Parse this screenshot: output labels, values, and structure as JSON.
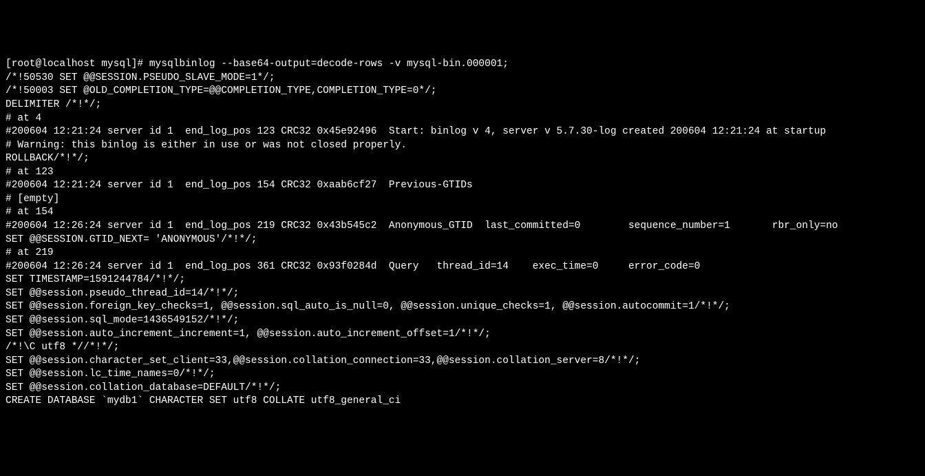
{
  "terminal": {
    "lines": [
      "[root@localhost mysql]# mysqlbinlog --base64-output=decode-rows -v mysql-bin.000001;",
      "/*!50530 SET @@SESSION.PSEUDO_SLAVE_MODE=1*/;",
      "/*!50003 SET @OLD_COMPLETION_TYPE=@@COMPLETION_TYPE,COMPLETION_TYPE=0*/;",
      "DELIMITER /*!*/;",
      "# at 4",
      "#200604 12:21:24 server id 1  end_log_pos 123 CRC32 0x45e92496  Start: binlog v 4, server v 5.7.30-log created 200604 12:21:24 at startup",
      "# Warning: this binlog is either in use or was not closed properly.",
      "ROLLBACK/*!*/;",
      "# at 123",
      "#200604 12:21:24 server id 1  end_log_pos 154 CRC32 0xaab6cf27  Previous-GTIDs",
      "# [empty]",
      "# at 154",
      "#200604 12:26:24 server id 1  end_log_pos 219 CRC32 0x43b545c2  Anonymous_GTID  last_committed=0        sequence_number=1       rbr_only=no",
      "SET @@SESSION.GTID_NEXT= 'ANONYMOUS'/*!*/;",
      "# at 219",
      "#200604 12:26:24 server id 1  end_log_pos 361 CRC32 0x93f0284d  Query   thread_id=14    exec_time=0     error_code=0",
      "SET TIMESTAMP=1591244784/*!*/;",
      "SET @@session.pseudo_thread_id=14/*!*/;",
      "SET @@session.foreign_key_checks=1, @@session.sql_auto_is_null=0, @@session.unique_checks=1, @@session.autocommit=1/*!*/;",
      "SET @@session.sql_mode=1436549152/*!*/;",
      "SET @@session.auto_increment_increment=1, @@session.auto_increment_offset=1/*!*/;",
      "/*!\\C utf8 *//*!*/;",
      "SET @@session.character_set_client=33,@@session.collation_connection=33,@@session.collation_server=8/*!*/;",
      "SET @@session.lc_time_names=0/*!*/;",
      "SET @@session.collation_database=DEFAULT/*!*/;",
      "CREATE DATABASE `mydb1` CHARACTER SET utf8 COLLATE utf8_general_ci"
    ]
  }
}
